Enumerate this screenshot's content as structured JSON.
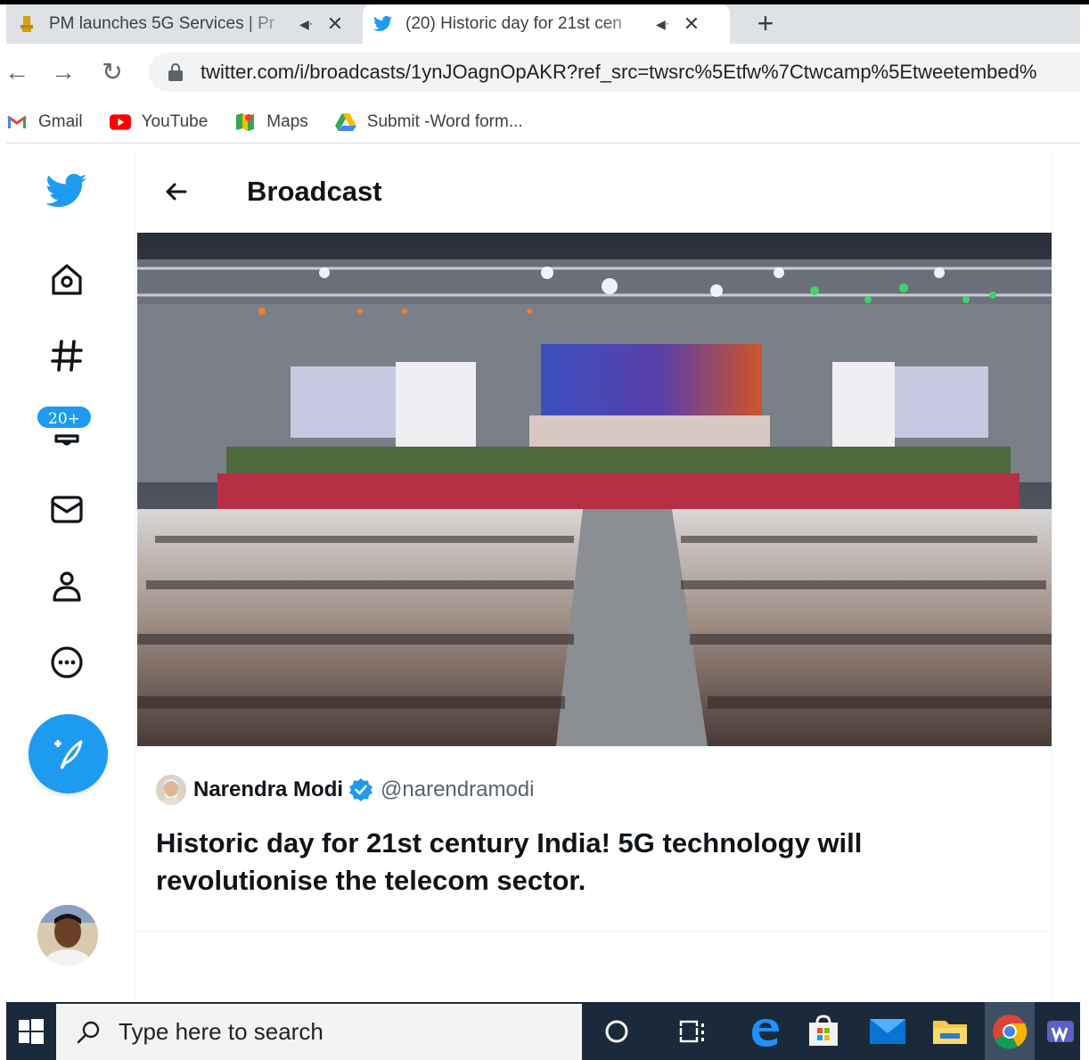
{
  "browser": {
    "tabs": [
      {
        "title": "PM launches 5G Services | Pr",
        "favicon": "emblem-icon",
        "audio": true,
        "active": false
      },
      {
        "title": "(20) Historic day for 21st cen",
        "favicon": "twitter-icon",
        "audio": true,
        "active": true
      }
    ],
    "new_tab_label": "+",
    "url": "twitter.com/i/broadcasts/1ynJOagnOpAKR?ref_src=twsrc%5Etfw%7Ctwcamp%5Etweetembed%",
    "bookmarks": [
      {
        "label": "Gmail",
        "icon": "gmail-icon"
      },
      {
        "label": "YouTube",
        "icon": "youtube-icon"
      },
      {
        "label": "Maps",
        "icon": "maps-icon"
      },
      {
        "label": "Submit -Word form...",
        "icon": "drive-icon"
      }
    ]
  },
  "twitter": {
    "nav": {
      "icons": [
        "twitter-logo-icon",
        "home-icon",
        "explore-icon",
        "notifications-icon",
        "messages-icon",
        "profile-icon",
        "more-icon"
      ],
      "notification_badge": "20+",
      "compose_icon": "compose-tweet-icon"
    },
    "header": {
      "title": "Broadcast"
    },
    "tweet": {
      "author_name": "Narendra Modi",
      "handle": "@narendramodi",
      "text": "Historic day for 21st century India! 5G technology will revolutionise the telecom sector."
    },
    "colors": {
      "brand": "#1d9bf0",
      "text": "#0f1419",
      "secondary_text": "#536471"
    }
  },
  "taskbar": {
    "search_placeholder": "Type here to search",
    "apps": [
      "cortana-icon",
      "task-view-icon",
      "edge-icon",
      "store-icon",
      "mail-icon",
      "file-explorer-icon",
      "chrome-icon",
      "teams-icon"
    ]
  }
}
